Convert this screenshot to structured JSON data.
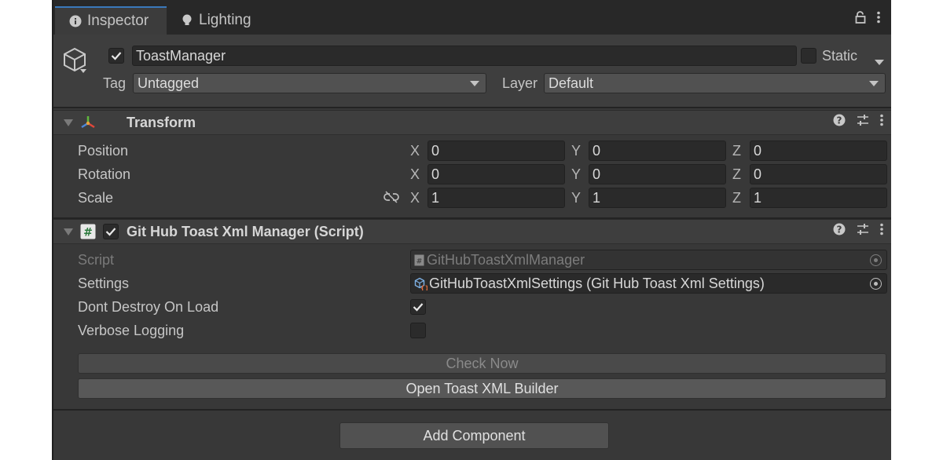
{
  "tabs": [
    {
      "label": "Inspector",
      "icon": "info-icon",
      "active": true
    },
    {
      "label": "Lighting",
      "icon": "lightbulb-icon",
      "active": false
    }
  ],
  "gameobject": {
    "active": true,
    "name": "ToastManager",
    "static_label": "Static",
    "static": false,
    "tag_label": "Tag",
    "tag_value": "Untagged",
    "layer_label": "Layer",
    "layer_value": "Default"
  },
  "transform": {
    "title": "Transform",
    "rows": [
      {
        "label": "Position",
        "x": "0",
        "y": "0",
        "z": "0"
      },
      {
        "label": "Rotation",
        "x": "0",
        "y": "0",
        "z": "0"
      },
      {
        "label": "Scale",
        "x": "1",
        "y": "1",
        "z": "1"
      }
    ],
    "axis_labels": {
      "x": "X",
      "y": "Y",
      "z": "Z"
    }
  },
  "script_component": {
    "title": "Git Hub Toast Xml Manager (Script)",
    "enabled": true,
    "script_label": "Script",
    "script_value": "GitHubToastXmlManager",
    "settings_label": "Settings",
    "settings_value": "GitHubToastXmlSettings (Git Hub Toast Xml Settings)",
    "dont_destroy_label": "Dont Destroy On Load",
    "dont_destroy": true,
    "verbose_label": "Verbose Logging",
    "verbose": false,
    "check_now_label": "Check Now",
    "open_builder_label": "Open Toast XML Builder"
  },
  "add_component_label": "Add Component",
  "colors": {
    "panel_bg": "#383838",
    "accent_tab": "#3a79bb",
    "field_bg": "#2a2a2a"
  }
}
